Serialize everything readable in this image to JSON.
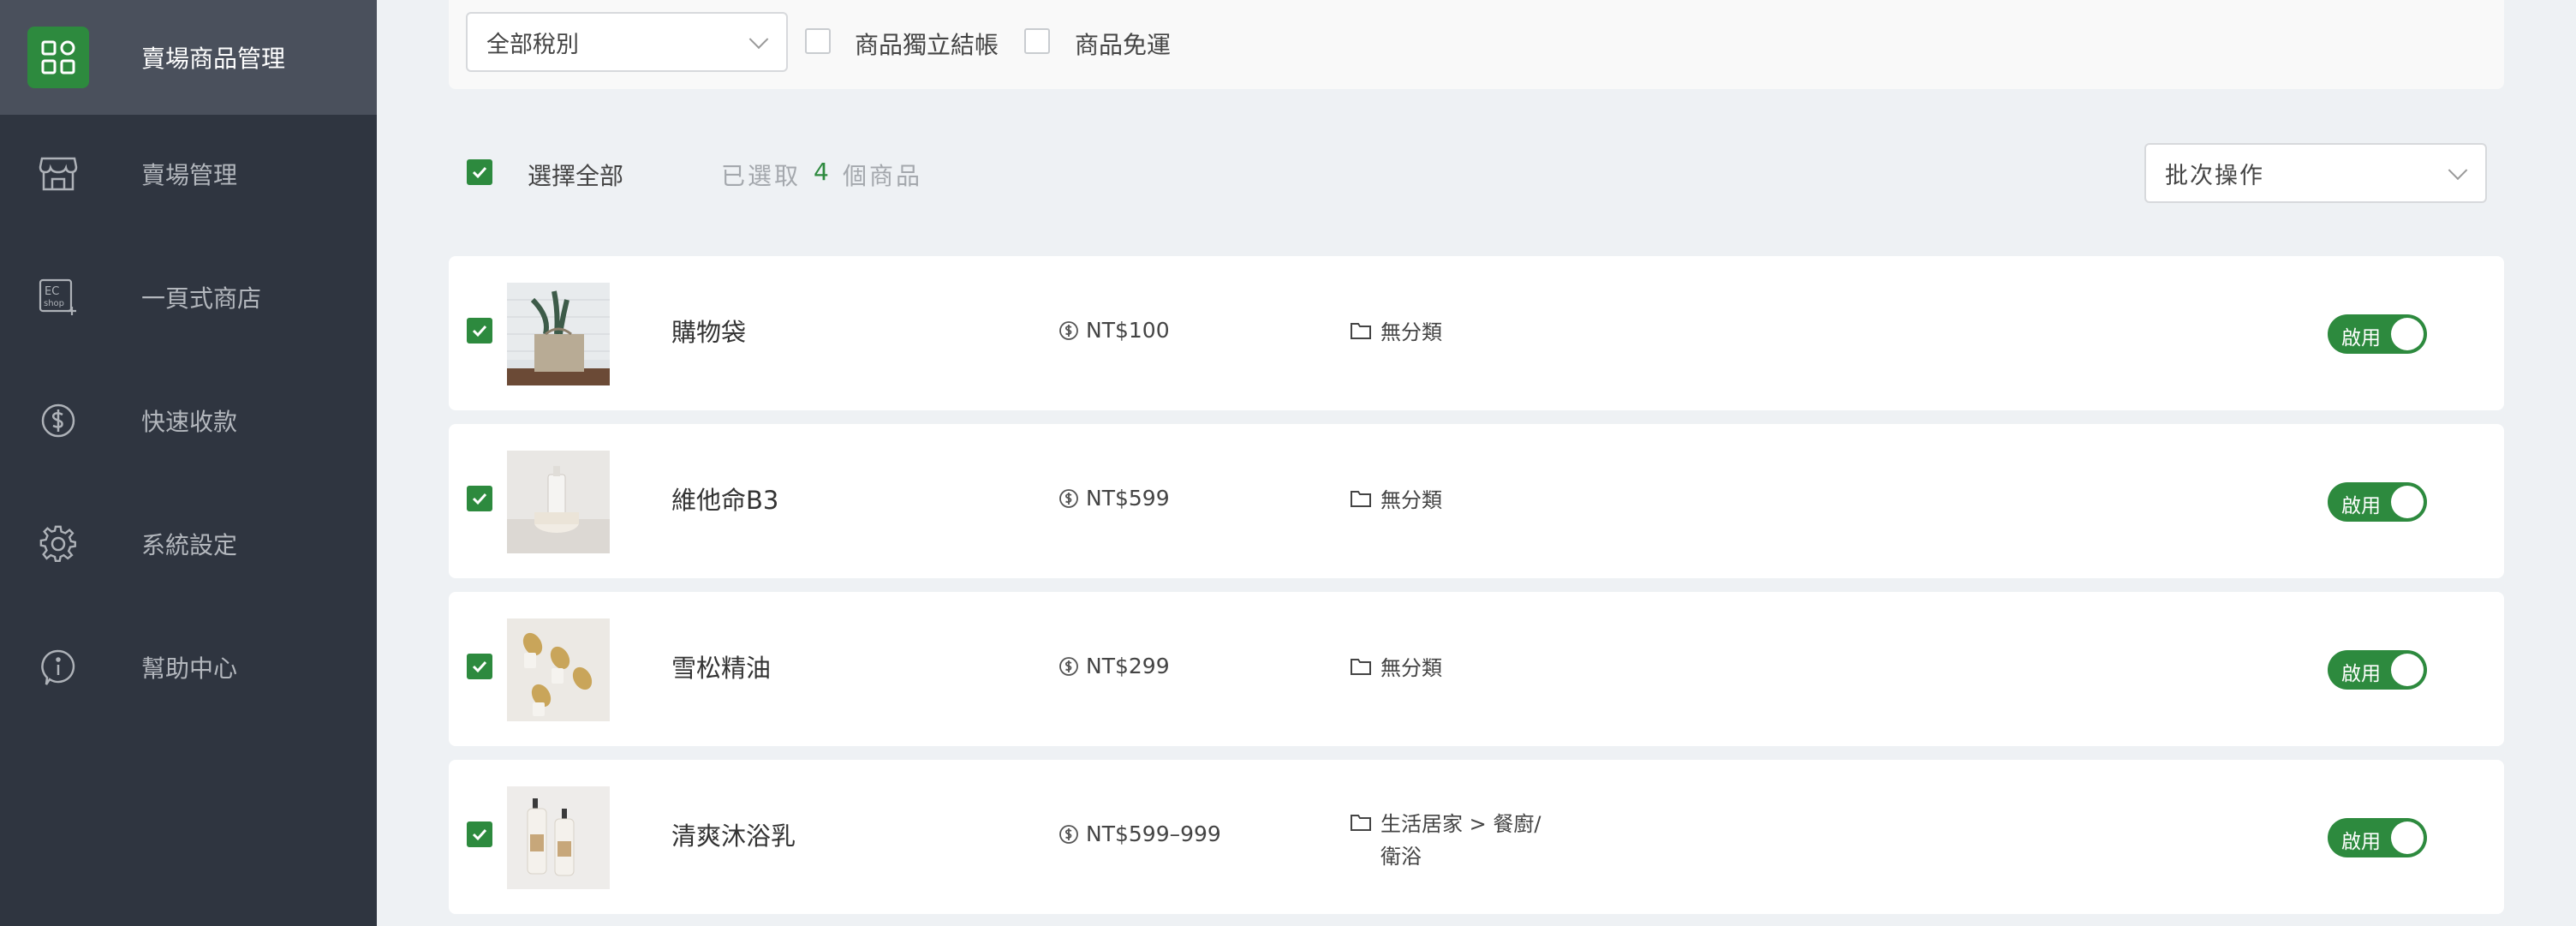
{
  "sidebar": {
    "items": [
      {
        "label": "賣場商品管理",
        "icon": "apps-icon",
        "active": true
      },
      {
        "label": "賣場管理",
        "icon": "store-icon"
      },
      {
        "label": "一頁式商店",
        "icon": "ec-shop-icon",
        "icon_text_top": "EC",
        "icon_text_bottom": "shop"
      },
      {
        "label": "快速收款",
        "icon": "dollar-circle-icon"
      },
      {
        "label": "系統設定",
        "icon": "gear-icon"
      },
      {
        "label": "幫助中心",
        "icon": "info-circle-icon"
      }
    ]
  },
  "filters": {
    "tax_select": "全部稅別",
    "independent_checkout_label": "商品獨立結帳",
    "free_shipping_label": "商品免運"
  },
  "selection": {
    "select_all_label": "選擇全部",
    "selected_prefix": "已選取",
    "selected_count": "4",
    "selected_suffix": "個商品",
    "batch_select": "批次操作"
  },
  "products": [
    {
      "name": "購物袋",
      "price": "NT$100",
      "category": "無分類",
      "status": "啟用",
      "enabled": true,
      "checked": true
    },
    {
      "name": "維他命B3",
      "price": "NT$599",
      "category": "無分類",
      "status": "啟用",
      "enabled": true,
      "checked": true
    },
    {
      "name": "雪松精油",
      "price": "NT$299",
      "category": "無分類",
      "status": "啟用",
      "enabled": true,
      "checked": true
    },
    {
      "name": "清爽沐浴乳",
      "price": "NT$599–999",
      "category": "生活居家 > 餐廚/衛浴",
      "status": "啟用",
      "enabled": true,
      "checked": true
    }
  ],
  "colors": {
    "accent": "#2d8a3e",
    "sidebar_bg": "#2f3540",
    "sidebar_active_bg": "#4a505c",
    "page_bg": "#eef1f4"
  }
}
